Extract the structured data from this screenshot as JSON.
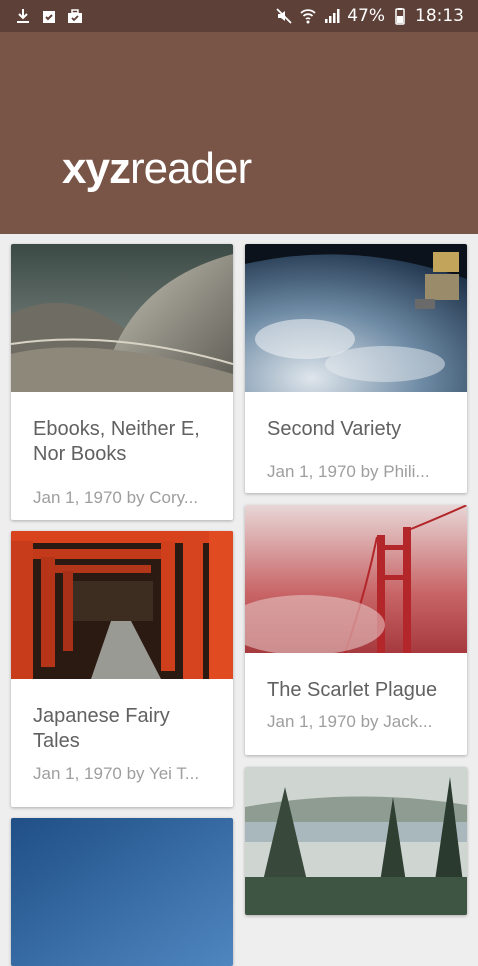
{
  "status_bar": {
    "left_icons": [
      "download-icon",
      "clipboard-check-icon",
      "briefcase-icon"
    ],
    "right_icons": [
      "mute-icon",
      "wifi-icon",
      "signal-icon"
    ],
    "battery": "47%",
    "time": "18:13",
    "background_color": "#5d4037"
  },
  "app_bar": {
    "logo_bold": "xyz",
    "logo_light": "reader",
    "background_color": "#795548"
  },
  "articles": [
    {
      "title": "Ebooks, Neither E, Nor Books",
      "subtitle": "Jan 1, 1970 by Cory...",
      "image": "sydney-opera-house-shells"
    },
    {
      "title": "Second Variety",
      "subtitle": "Jan 1, 1970 by Phili...",
      "image": "earth-from-orbit-station"
    },
    {
      "title": "Japanese Fairy Tales",
      "subtitle": "Jan 1, 1970 by Yei T...",
      "image": "torii-gates-path"
    },
    {
      "title": "The Scarlet Plague",
      "subtitle": "Jan 1, 1970 by Jack...",
      "image": "bridge-in-red-fog"
    },
    {
      "title": "",
      "subtitle": "",
      "image": "blue-sky"
    },
    {
      "title": "",
      "subtitle": "",
      "image": "forest-lake"
    }
  ]
}
